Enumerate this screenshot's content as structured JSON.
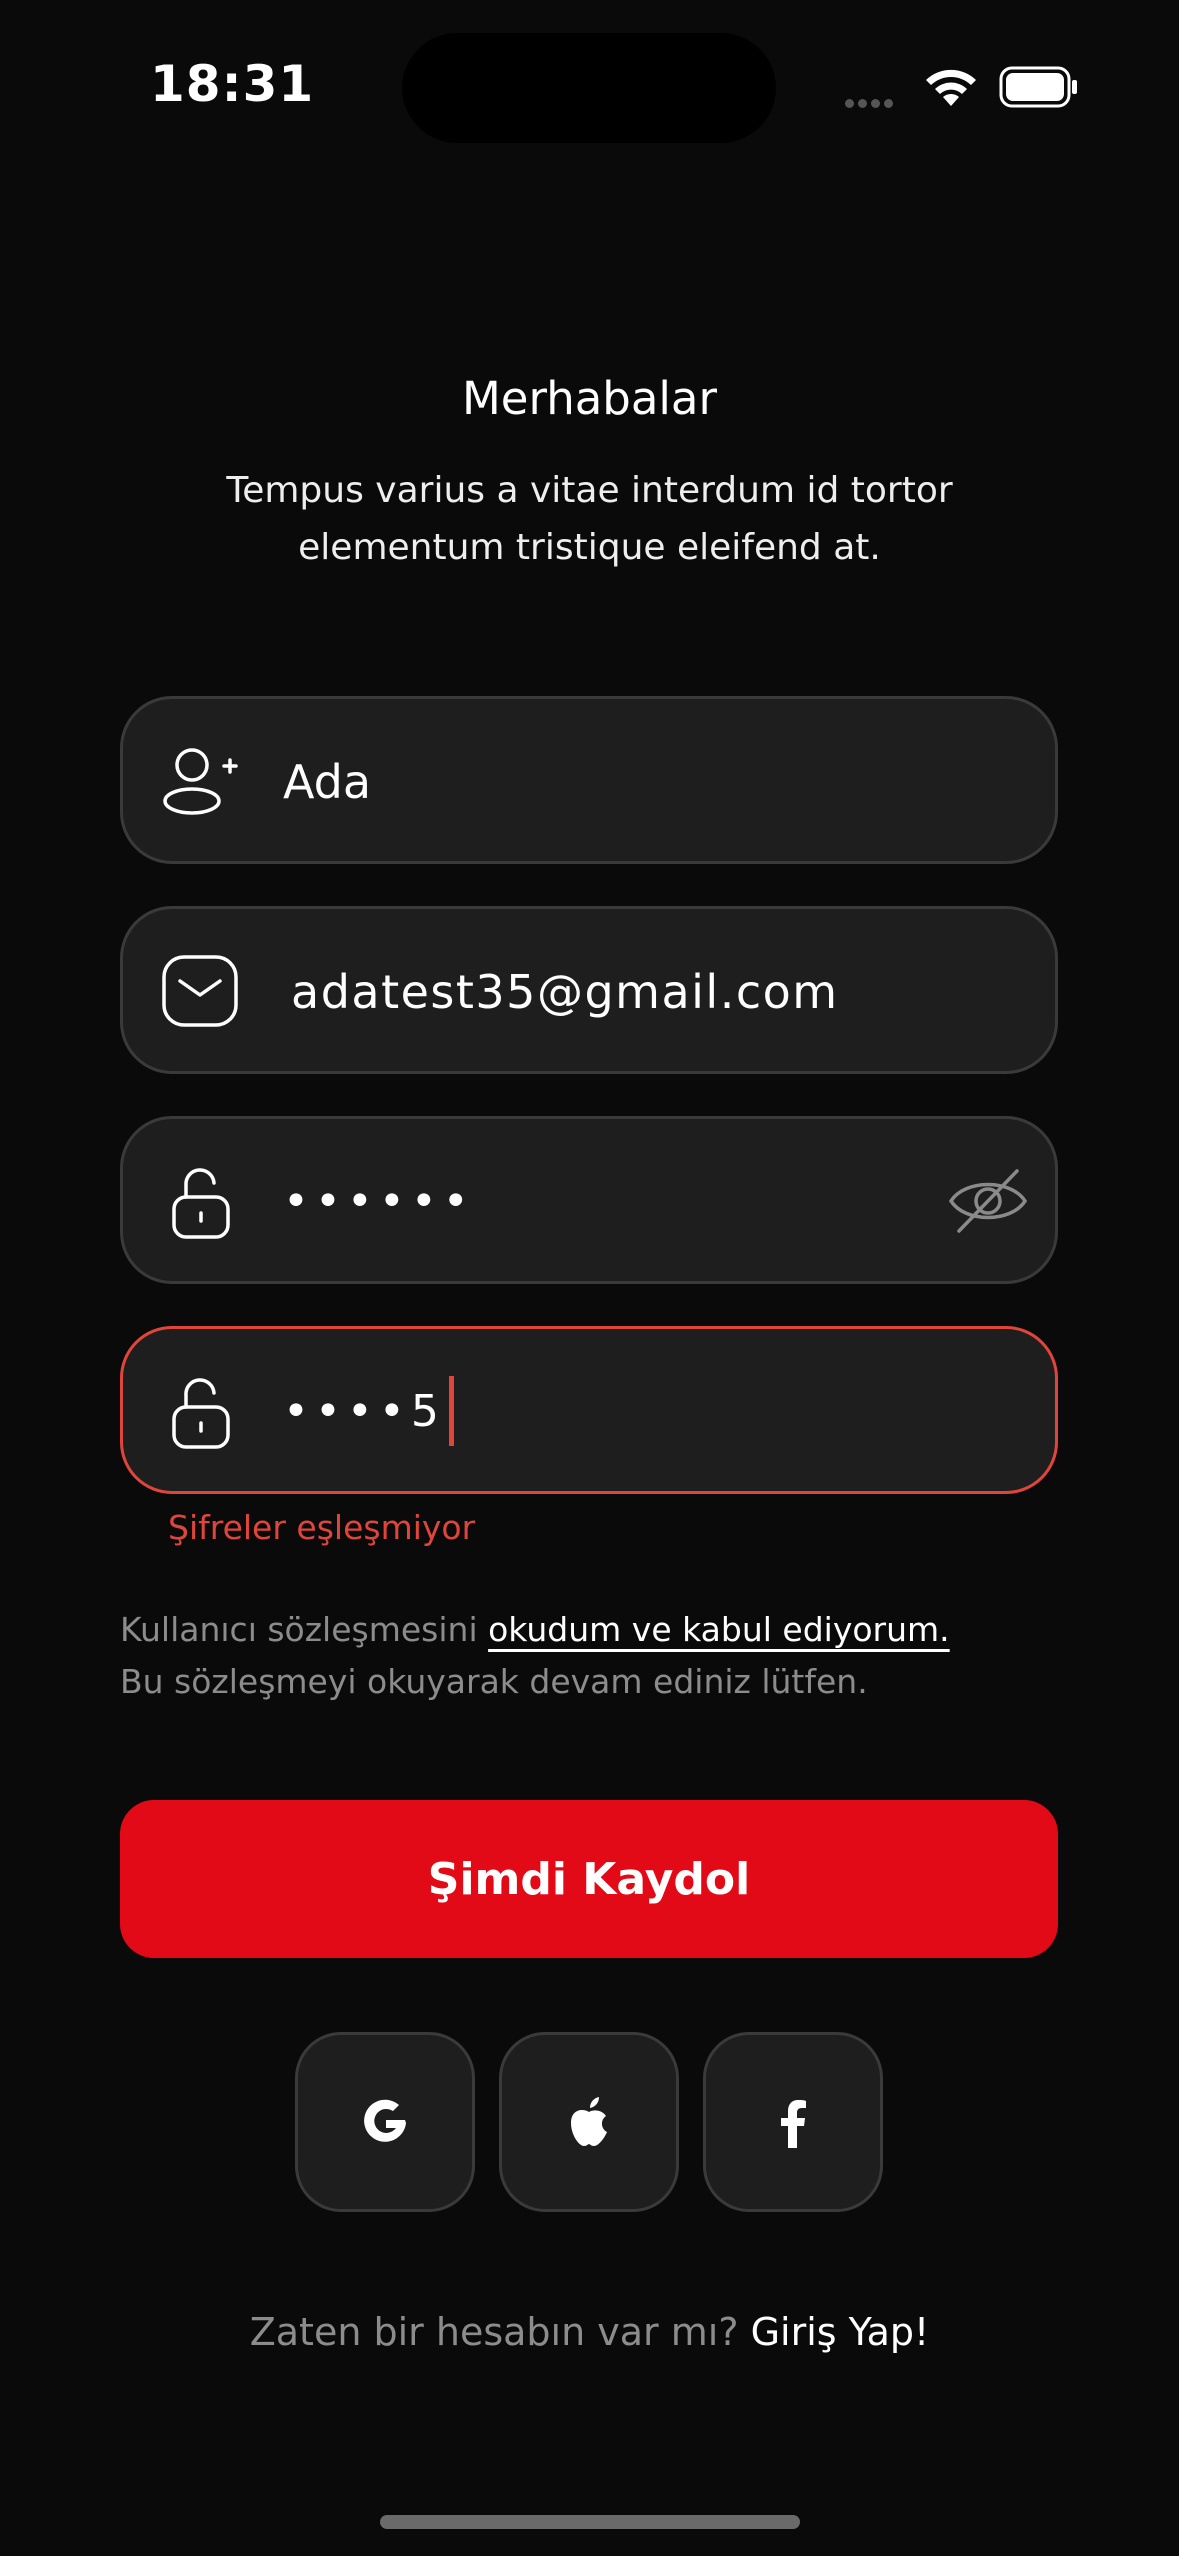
{
  "status_bar": {
    "time": "18:31"
  },
  "header": {
    "title": "Merhabalar",
    "subtitle": "Tempus varius a vitae interdum id tortor elementum tristique eleifend at."
  },
  "form": {
    "name": {
      "value": "Ada",
      "icon": "add-user-icon"
    },
    "email": {
      "value": "adatest35@gmail.com",
      "icon": "mail-icon"
    },
    "password": {
      "value": "••••••",
      "icon": "unlock-icon",
      "toggle_icon": "eye-off-icon"
    },
    "password_confirm": {
      "value": "••••5",
      "icon": "unlock-icon",
      "error": "Şifreler eşleşmiyor"
    }
  },
  "terms": {
    "prefix": "Kullanıcı sözleşmesini ",
    "link": "okudum ve kabul ediyorum.",
    "line2": "Bu sözleşmeyi okuyarak devam ediniz lütfen."
  },
  "cta": {
    "label": "Şimdi Kaydol"
  },
  "social": [
    {
      "name": "google-icon"
    },
    {
      "name": "apple-icon"
    },
    {
      "name": "facebook-icon"
    }
  ],
  "footer": {
    "question": "Zaten bir hesabın var mı?",
    "link": "Giriş Yap!"
  },
  "colors": {
    "accent": "#e30a17",
    "error": "#e0453c",
    "background": "#0a0a0a",
    "field": "#1e1e1e"
  }
}
